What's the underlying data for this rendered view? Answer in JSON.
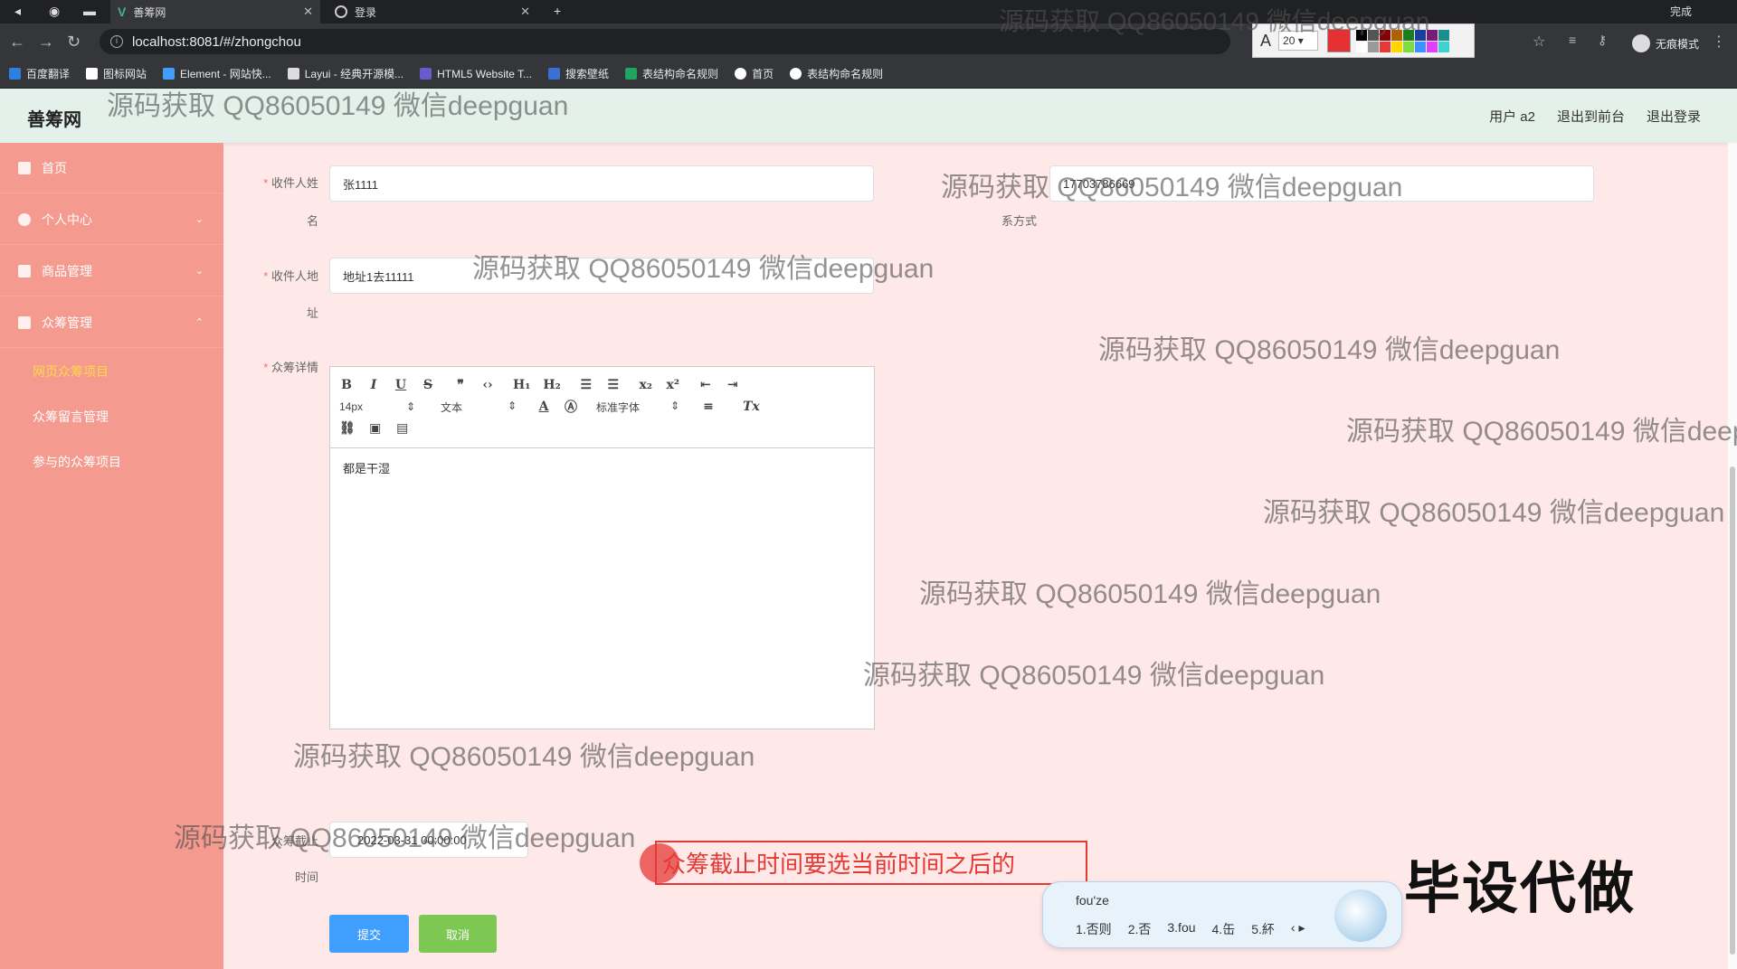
{
  "browser": {
    "tabs": [
      {
        "label": "善筹网",
        "active": true
      },
      {
        "label": "登录",
        "active": false
      }
    ],
    "url": "localhost:8081/#/zhongchou",
    "incognito_label": "无痕模式",
    "bookmarks": [
      "百度翻译",
      "图标网站",
      "Element - 网站快...",
      "Layui - 经典开源模...",
      "HTML5 Website T...",
      "搜索壁纸",
      "表结构命名规则",
      "首页",
      "表结构命名规则"
    ],
    "annotation_tool": {
      "font_size": "20",
      "done_label": "完成"
    }
  },
  "header": {
    "logo": "善筹网",
    "links": [
      "用户 a2",
      "退出到前台",
      "退出登录"
    ]
  },
  "sidebar": {
    "items": [
      {
        "label": "首页"
      },
      {
        "label": "个人中心"
      },
      {
        "label": "商品管理"
      },
      {
        "label": "众筹管理"
      }
    ],
    "subitems": [
      {
        "label": "网页众筹项目",
        "active": true
      },
      {
        "label": "众筹留言管理",
        "active": false
      },
      {
        "label": "参与的众筹项目",
        "active": false
      }
    ]
  },
  "form": {
    "recipient_name": {
      "label_line1": "收件人姓",
      "label_line2": "名",
      "value": "张1111"
    },
    "contact": {
      "label_line1": "联系方式",
      "label_line2": "系方式",
      "value": "17703786669"
    },
    "address": {
      "label_line1": "收件人地",
      "label_line2": "址",
      "value": "地址1去11111"
    },
    "details": {
      "label": "众筹详情",
      "content": "都是干湿"
    },
    "deadline": {
      "label_line1": "众筹截止",
      "label_line2": "时间",
      "value": "2022-03-31 00:00:00"
    },
    "submit_label": "提交",
    "cancel_label": "取消"
  },
  "editor": {
    "font_size": "14px",
    "paragraph": "文本",
    "font_family": "标准字体"
  },
  "overlays": {
    "watermark_text": "源码获取 QQ86050149 微信deepguan",
    "annotation_text": "众筹截止时间要选当前时间之后的",
    "big_tag": "毕设代做",
    "ime": {
      "input": "fou'ze",
      "candidates": [
        "1.否则",
        "2.否",
        "3.fou",
        "4.缶",
        "5.紑"
      ]
    }
  }
}
